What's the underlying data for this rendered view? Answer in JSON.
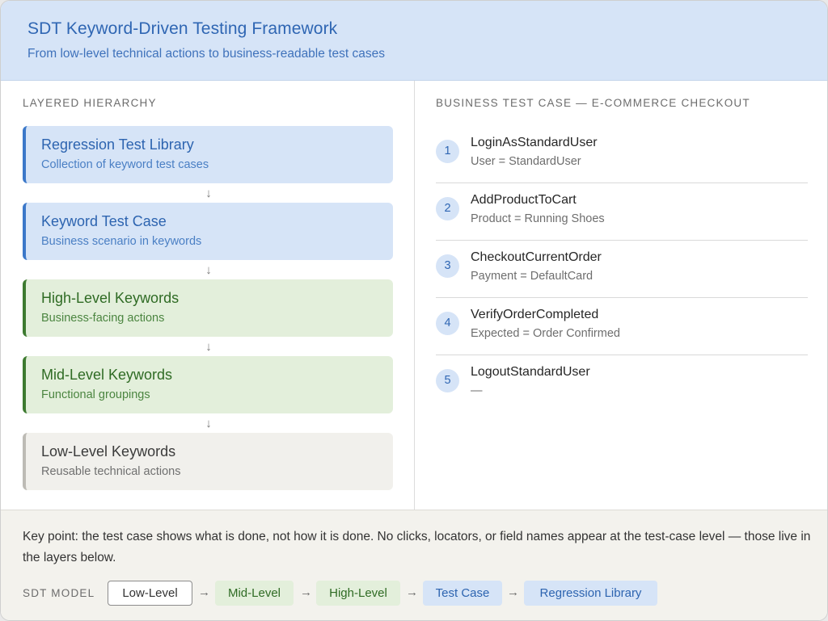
{
  "header": {
    "title": "SDT Keyword-Driven Testing Framework",
    "subtitle": "From low-level technical actions to business-readable test cases"
  },
  "hierarchy": {
    "label": "LAYERED HIERARCHY",
    "arrow": "↓",
    "layers": [
      {
        "title": "Regression Test Library",
        "subtitle": "Collection of keyword test cases",
        "color": "#3b78c9"
      },
      {
        "title": "Keyword Test Case",
        "subtitle": "Business scenario in keywords",
        "color": "#3b78c9"
      },
      {
        "title": "High-Level Keywords",
        "subtitle": "Business-facing actions",
        "color": "#3d7a30"
      },
      {
        "title": "Mid-Level Keywords",
        "subtitle": "Functional groupings",
        "color": "#3d7a30"
      },
      {
        "title": "Low-Level Keywords",
        "subtitle": "Reusable technical actions",
        "color": "#bdbbb5"
      }
    ]
  },
  "test_case": {
    "label": "BUSINESS TEST CASE — E-COMMERCE CHECKOUT",
    "steps": [
      {
        "num": "1",
        "name": "LoginAsStandardUser",
        "param": "User = StandardUser"
      },
      {
        "num": "2",
        "name": "AddProductToCart",
        "param": "Product = Running Shoes"
      },
      {
        "num": "3",
        "name": "CheckoutCurrentOrder",
        "param": "Payment = DefaultCard"
      },
      {
        "num": "4",
        "name": "VerifyOrderCompleted",
        "param": "Expected = Order Confirmed"
      },
      {
        "num": "5",
        "name": "LogoutStandardUser",
        "param": "—"
      }
    ]
  },
  "footer": {
    "key_point": "Key point: the test case shows what is done, not how it is done. No clicks, locators, or field names appear at the test-case level — those live in the layers below.",
    "model_label": "SDT MODEL",
    "arrow": "→",
    "chain": [
      "Low-Level",
      "Mid-Level",
      "High-Level",
      "Test Case",
      "Regression Library"
    ]
  }
}
